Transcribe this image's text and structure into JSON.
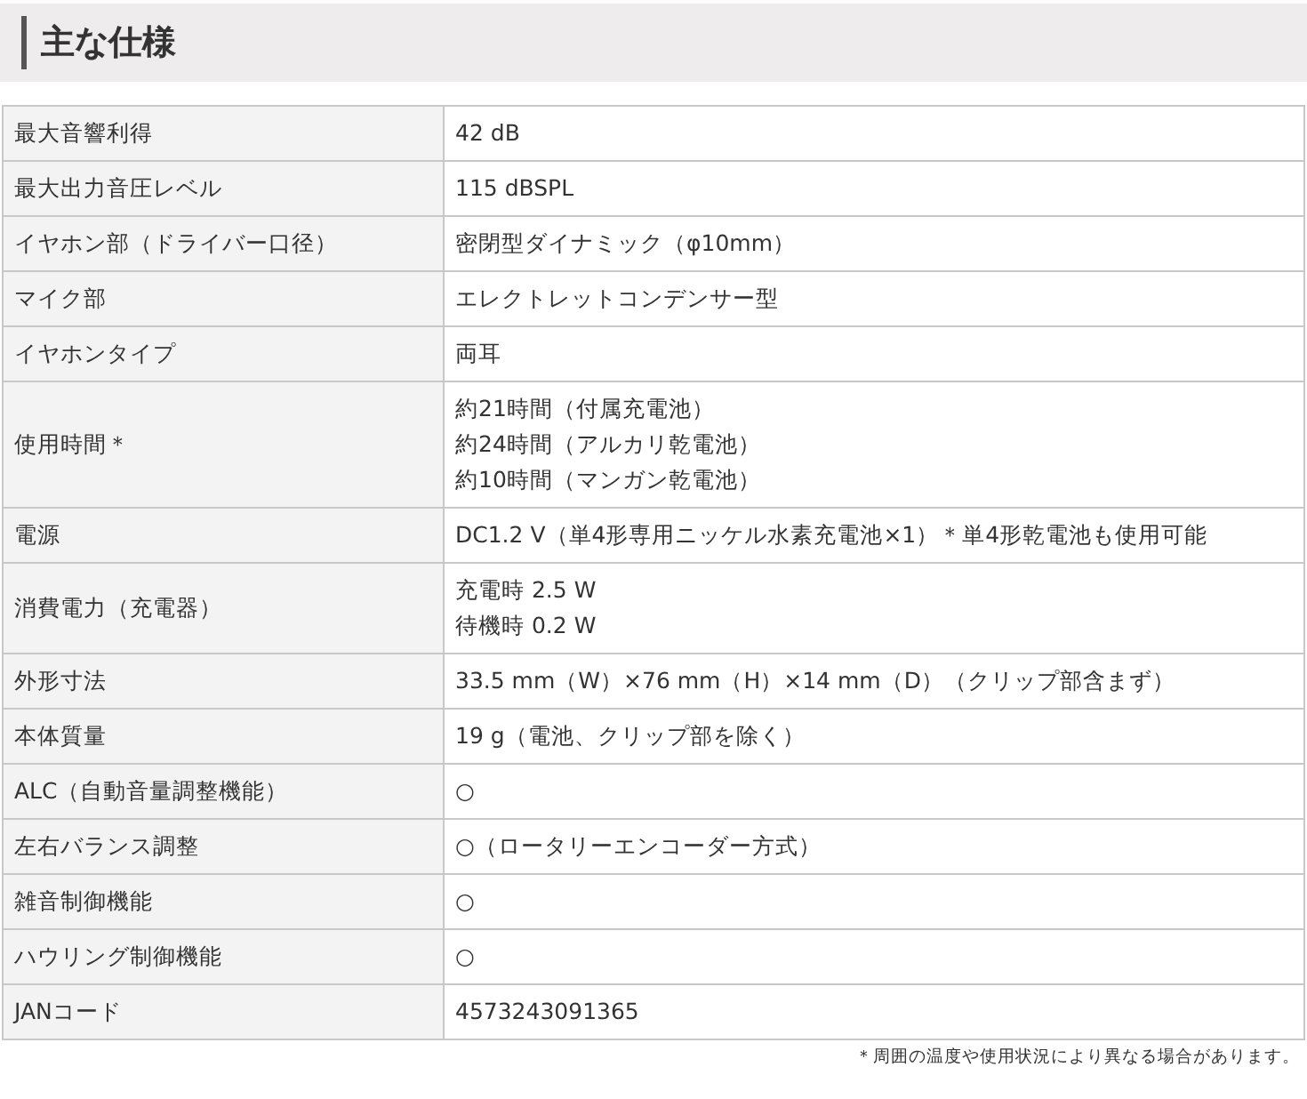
{
  "heading": "主な仕様",
  "specs": [
    {
      "label": "最大音響利得",
      "value": [
        "42 dB"
      ]
    },
    {
      "label": "最大出力音圧レベル",
      "value": [
        "115 dBSPL"
      ]
    },
    {
      "label": "イヤホン部（ドライバー口径）",
      "value": [
        "密閉型ダイナミック（φ10mm）"
      ]
    },
    {
      "label": "マイク部",
      "value": [
        "エレクトレットコンデンサー型"
      ]
    },
    {
      "label": "イヤホンタイプ",
      "value": [
        "両耳"
      ]
    },
    {
      "label": "使用時間＊",
      "value": [
        "約21時間（付属充電池）",
        "約24時間（アルカリ乾電池）",
        "約10時間（マンガン乾電池）"
      ]
    },
    {
      "label": "電源",
      "value": [
        "DC1.2 V（単4形専用ニッケル水素充電池×1）＊単4形乾電池も使用可能"
      ]
    },
    {
      "label": "消費電力（充電器）",
      "value": [
        "充電時 2.5 W",
        "待機時 0.2 W"
      ]
    },
    {
      "label": "外形寸法",
      "value": [
        "33.5 mm（W）×76 mm（H）×14 mm（D）（クリップ部含まず）"
      ]
    },
    {
      "label": "本体質量",
      "value": [
        "19 g（電池、クリップ部を除く）"
      ]
    },
    {
      "label": "ALC（自動音量調整機能）",
      "value": [
        "○"
      ]
    },
    {
      "label": "左右バランス調整",
      "value": [
        "○（ロータリーエンコーダー方式）"
      ]
    },
    {
      "label": "雑音制御機能",
      "value": [
        "○"
      ]
    },
    {
      "label": "ハウリング制御機能",
      "value": [
        "○"
      ]
    },
    {
      "label": "JANコード",
      "value": [
        "4573243091365"
      ]
    }
  ],
  "footnote": "＊周囲の温度や使用状況により異なる場合があります。"
}
